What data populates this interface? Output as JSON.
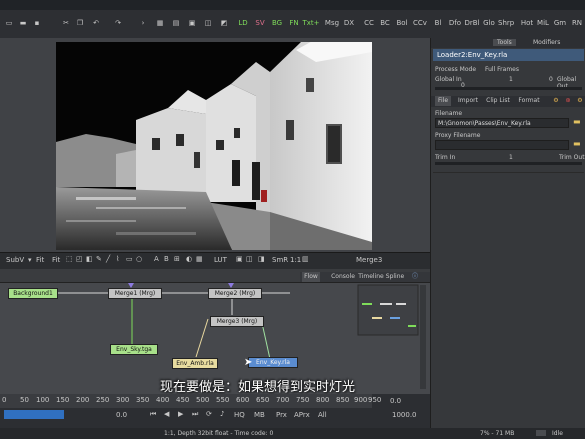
{
  "toolbar": {
    "panel_buttons": [
      "LD",
      "SV",
      "BG",
      "FN",
      "Txt+",
      "Msg",
      "DX",
      "CC",
      "BC",
      "Bol",
      "CCv",
      "Bl",
      "Dfo",
      "DrBl",
      "Glo",
      "Shrp",
      "Hot",
      "MiL",
      "Gm",
      "RN"
    ],
    "colors": {
      "green": "#7fdc5a",
      "cyan": "#65d0d8",
      "pink": "#e0708c"
    }
  },
  "viewer": {
    "toolbar_items": [
      "SubV",
      "Fit",
      "Fit",
      "LUT",
      "SmR",
      "1:1"
    ],
    "view_name": "Merge3"
  },
  "flow": {
    "tabs": [
      "Flow",
      "Console",
      "Timeline",
      "Spline"
    ],
    "nodes": {
      "background": "Background1",
      "merge1": "Merge1 (Mrg)",
      "merge2": "Merge2 (Mrg)",
      "merge3": "Merge3 (Mrg)",
      "env_sky": "Env_Sky.tga",
      "env_amb": "Env_Amb.rla",
      "env_key": "Env_Key.rla"
    }
  },
  "subtitle": "现在要做是：如果想得到实时灯光",
  "timeline": {
    "ticks": [
      "0",
      "50",
      "100",
      "150",
      "200",
      "250",
      "300",
      "350",
      "400",
      "450",
      "500",
      "550",
      "600",
      "650",
      "700",
      "750",
      "800",
      "850",
      "900",
      "950"
    ],
    "current_value": "0.0",
    "end_value": "1000.0",
    "render_value": "0.0",
    "buttons": [
      "HQ",
      "MB",
      "Prx",
      "APrx",
      "All"
    ]
  },
  "right_panel": {
    "node_title": "Loader2:Env_Key.rla",
    "header_tabs": [
      "Tools",
      "Modifiers"
    ],
    "process_mode_label": "Process Mode",
    "process_mode_value": "Full Frames",
    "global_in_label": "Global In",
    "global_out_label": "Global Out",
    "global_in_value": "0",
    "global_mid_value": "1",
    "global_out_value": "0",
    "sub_tabs": [
      "File",
      "Import",
      "Clip List",
      "Format"
    ],
    "filename_label": "Filename",
    "filename_value": "M:\\Gnomon\\Passes\\Env_Key.rla",
    "proxy_label": "Proxy Filename",
    "trim_in_label": "Trim In",
    "trim_out_label": "Trim Out",
    "trim_mid_value": "1"
  },
  "status": {
    "left_text": "1:1, Depth 32bit float - Time code: 0",
    "memory": "7% - 71 MB",
    "state": "Idle"
  }
}
